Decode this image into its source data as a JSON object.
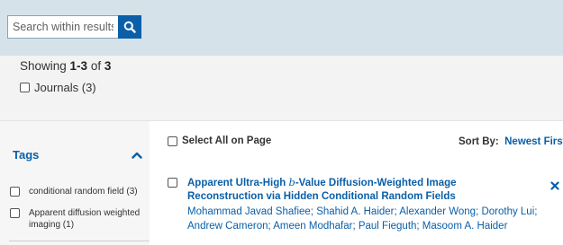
{
  "search": {
    "placeholder": "Search within results"
  },
  "results_summary": {
    "prefix": "Showing ",
    "range": "1-3",
    "of_text": " of ",
    "total": "3"
  },
  "facets": [
    {
      "label": "Journals (3)"
    }
  ],
  "sidebar": {
    "tags_heading": "Tags",
    "tags": [
      {
        "label": "conditional random field (3)"
      },
      {
        "label": "Apparent diffusion weighted imaging (1)"
      }
    ]
  },
  "toolbar": {
    "select_all_label": "Select All on Page",
    "sort_label": "Sort By:",
    "sort_value": "Newest First"
  },
  "results": [
    {
      "title": "Apparent Ultra-High b-Value Diffusion-Weighted Image Reconstruction via Hidden Conditional Random Fields",
      "title_before": "Apparent Ultra-High ",
      "title_b": "b",
      "title_after": "-Value Diffusion-Weighted Image Reconstruction via Hidden Conditional Random Fields",
      "authors": "Mohammad Javad Shafiee; Shahid A. Haider; Alexander Wong; Dorothy Lui; Andrew Cameron; Ameen Modhafar; Paul Fieguth; Masoom A. Haider"
    }
  ],
  "colors": {
    "accent": "#0a5fa8",
    "topbar": "#d6e2ea",
    "facet_bg": "#f3f3f3",
    "sidebar_bg": "#f6f6f6"
  },
  "icons": {
    "search": "search-icon",
    "collapse": "chevron-up-icon",
    "remove": "close-icon"
  }
}
